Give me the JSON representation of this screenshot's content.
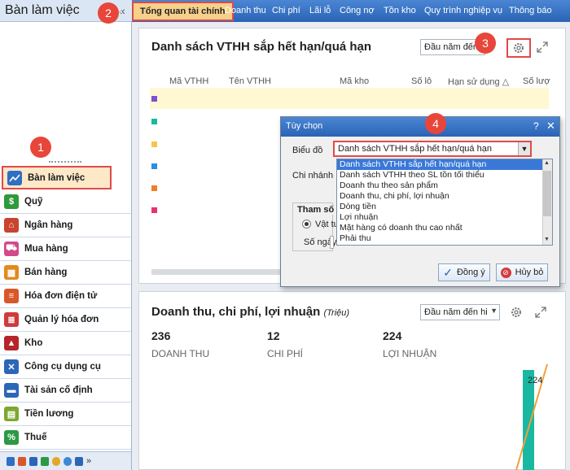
{
  "sidebar": {
    "title": "Bàn làm việc",
    "collapse_glyph": "«",
    "items": [
      {
        "label": "Bàn làm việc",
        "icon": "dashboard-icon",
        "color": "#2f6fc4"
      },
      {
        "label": "Quỹ",
        "icon": "cash-icon",
        "color": "#2e9a3a"
      },
      {
        "label": "Ngân hàng",
        "icon": "bank-icon",
        "color": "#c9432f"
      },
      {
        "label": "Mua hàng",
        "icon": "cart-icon",
        "color": "#d24a8a"
      },
      {
        "label": "Bán hàng",
        "icon": "store-icon",
        "color": "#e38a1e"
      },
      {
        "label": "Hóa đơn điện tử",
        "icon": "e-invoice-icon",
        "color": "#d9582a"
      },
      {
        "label": "Quản lý hóa đơn",
        "icon": "invoice-icon",
        "color": "#cf3b3b"
      },
      {
        "label": "Kho",
        "icon": "warehouse-icon",
        "color": "#b5252b"
      },
      {
        "label": "Công cụ dụng cụ",
        "icon": "tools-icon",
        "color": "#2c66b8"
      },
      {
        "label": "Tài sản cố định",
        "icon": "asset-icon",
        "color": "#2c66b8"
      },
      {
        "label": "Tiền lương",
        "icon": "salary-icon",
        "color": "#7ca830"
      },
      {
        "label": "Thuế",
        "icon": "tax-icon",
        "color": "#2c9a44"
      }
    ],
    "bottom_icons": [
      "chart-mini-icon",
      "doc-mini-icon",
      "calendar-mini-icon",
      "tax-mini-icon",
      "user-mini-icon",
      "group-mini-icon",
      "truck-mini-icon"
    ],
    "more_glyph": "»"
  },
  "tabs": {
    "prev_glyph": "‹",
    "items": [
      "Tổng quan tài chính",
      "Doanh thu",
      "Chi phí",
      "Lãi lỗ",
      "Công nợ",
      "Tồn kho",
      "Quy trình nghiệp vụ",
      "Thông báo"
    ]
  },
  "badges": [
    "1",
    "2",
    "3",
    "4"
  ],
  "card1": {
    "title": "Danh sách VTHH sắp hết hạn/quá hạn",
    "period": "Đầu năm đến h",
    "columns": [
      "Mã VTHH",
      "Tên VTHH",
      "Mã kho",
      "Số lô",
      "Hạn sử dụng △",
      "Số lượ"
    ],
    "row_colors": [
      "#7a4fd6",
      "#19b8a2",
      "#f3c74a",
      "#2c8fe0",
      "#f07d2a",
      "#e8336d"
    ]
  },
  "card2": {
    "title": "Doanh thu, chi phí, lợi nhuận",
    "unit": "(Triệu)",
    "period": "Đầu năm đến hi",
    "kpis": [
      {
        "value": "236",
        "label": "DOANH THU"
      },
      {
        "value": "12",
        "label": "CHI PHÍ"
      },
      {
        "value": "224",
        "label": "LỢI NHUẬN"
      }
    ],
    "bar_label": "224"
  },
  "dialog": {
    "title": "Tùy chọn",
    "help": "?",
    "close": "✕",
    "chart_label": "Biểu đồ",
    "chart_value": "Danh sách VTHH sắp hết hạn/quá hạn",
    "branch_label": "Chi nhánh",
    "param_label": "Tham số",
    "radio_label": "Vật tư",
    "days_label": "Số ngày",
    "options": [
      "Danh sách VTHH sắp hết hạn/quá hạn",
      "Danh sách VTHH theo SL tồn tối thiểu",
      "Doanh thu theo sản phẩm",
      "Doanh thu, chi phí, lợi nhuận",
      "Dòng tiền",
      "Lợi nhuận",
      "Mặt hàng có doanh thu cao nhất",
      "Phải thu"
    ],
    "ok": "Đồng ý",
    "cancel": "Hủy bỏ"
  }
}
